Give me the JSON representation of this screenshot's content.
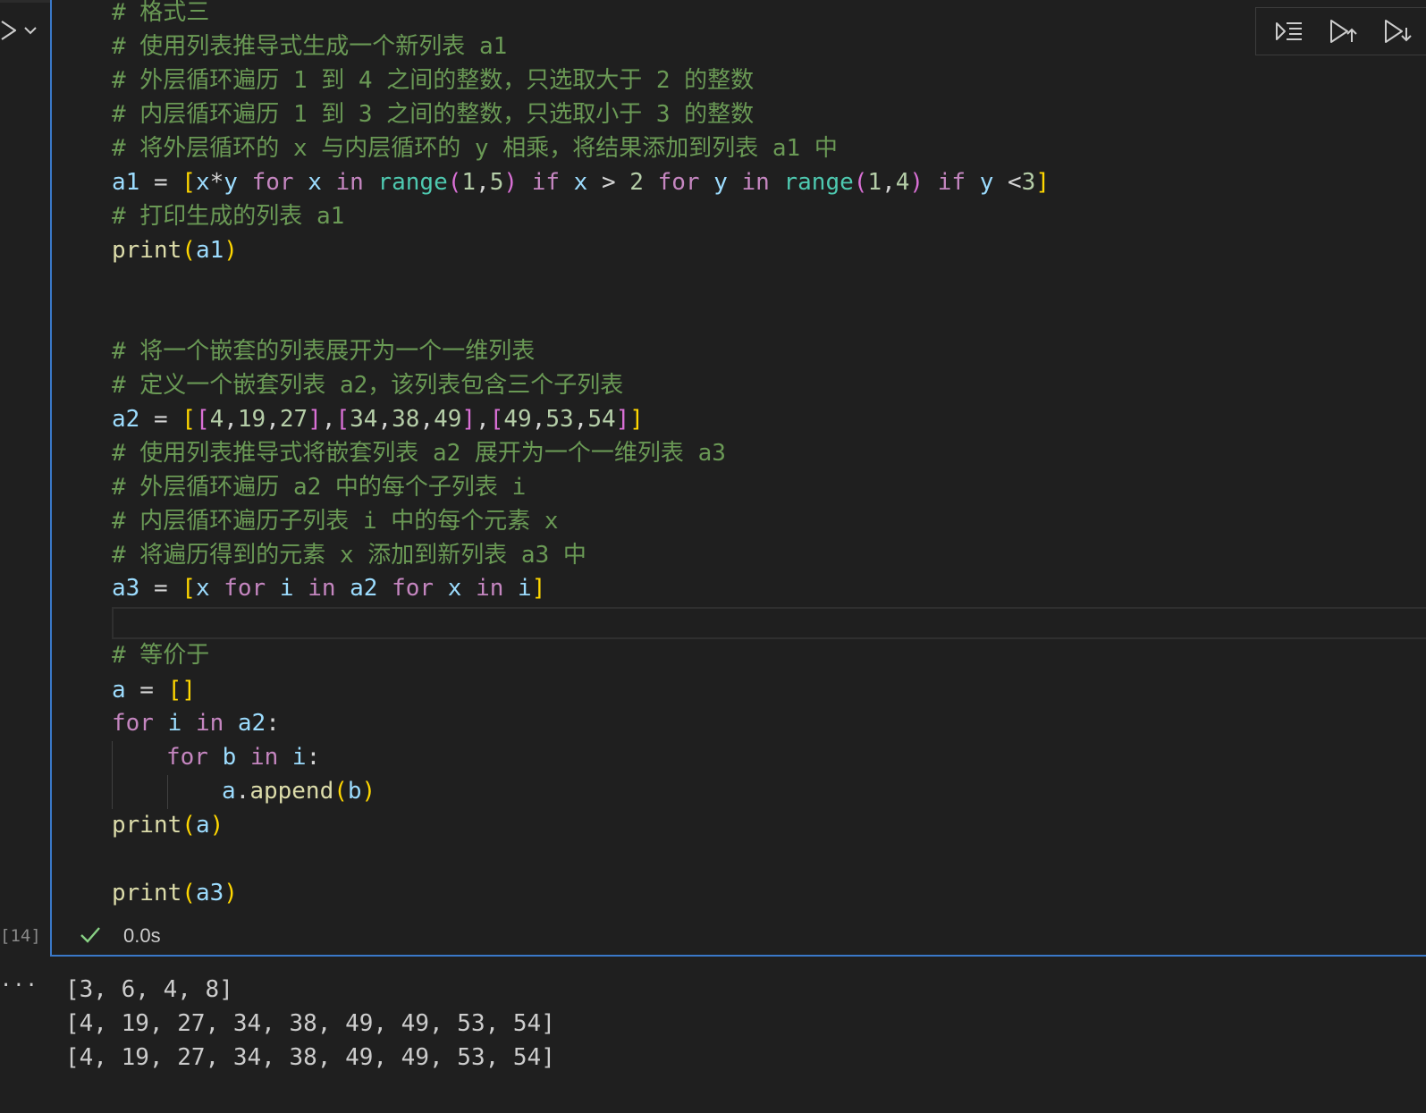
{
  "cell": {
    "execution_count": "[14]",
    "status_time": "0.0s",
    "status": "success"
  },
  "code": {
    "c1": "# 格式三",
    "c2": "# 使用列表推导式生成一个新列表 a1",
    "c3": "# 外层循环遍历 1 到 4 之间的整数，只选取大于 2 的整数",
    "c4": "# 内层循环遍历 1 到 3 之间的整数，只选取小于 3 的整数",
    "c5": "# 将外层循环的 x 与内层循环的 y 相乘，将结果添加到列表 a1 中",
    "c6": "# 打印生成的列表 a1",
    "c7": "# 将一个嵌套的列表展开为一个一维列表",
    "c8": "# 定义一个嵌套列表 a2，该列表包含三个子列表",
    "c9": "# 使用列表推导式将嵌套列表 a2 展开为一个一维列表 a3",
    "c10": "# 外层循环遍历 a2 中的每个子列表 i",
    "c11": "# 内层循环遍历子列表 i 中的每个元素 x",
    "c12": "# 将遍历得到的元素 x 添加到新列表 a3 中",
    "c13": "# 等价于"
  },
  "outputs": [
    "[3, 6, 4, 8]",
    "[4, 19, 27, 34, 38, 49, 49, 53, 54]",
    "[4, 19, 27, 34, 38, 49, 49, 53, 54]"
  ],
  "toolbar": {
    "icons": [
      "execute-above-below-icon",
      "run-above-icon",
      "run-below-icon"
    ]
  },
  "colors": {
    "cell_border": "#3a78c8",
    "comment": "#6a9955",
    "keyword": "#c586c0",
    "builtin": "#4ec9b0",
    "variable": "#9cdcfe",
    "number": "#b5cea8",
    "bracket_gold": "#ffd700",
    "bracket_purple": "#da70d6",
    "success": "#89d185"
  }
}
